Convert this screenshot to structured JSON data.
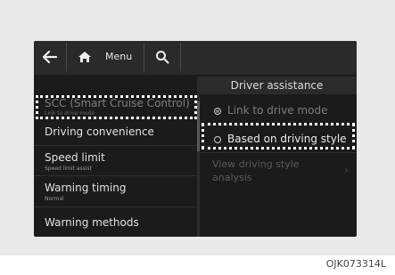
{
  "topbar": {
    "back_icon": "back-arrow-icon",
    "home_icon": "home-icon",
    "menu_label": "Menu",
    "search_icon": "search-icon"
  },
  "right": {
    "title": "Driver assistance",
    "options": [
      {
        "label": "Link to drive mode",
        "selected": true,
        "enabled": false
      },
      {
        "label": "Based on driving style",
        "selected": false,
        "enabled": true
      }
    ],
    "analysis_label_line1": "View driving style",
    "analysis_label_line2": "analysis",
    "analysis_chevron": "›"
  },
  "left": {
    "items": [
      {
        "label": "SCC (Smart Cruise Control)",
        "sub": "Link to drive mode"
      },
      {
        "label": "Driving convenience",
        "sub": ""
      },
      {
        "label": "Speed limit",
        "sub": "Speed limit assist"
      },
      {
        "label": "Warning timing",
        "sub": "Normal"
      },
      {
        "label": "Warning methods",
        "sub": ""
      }
    ]
  },
  "caption": "OJK073314L"
}
